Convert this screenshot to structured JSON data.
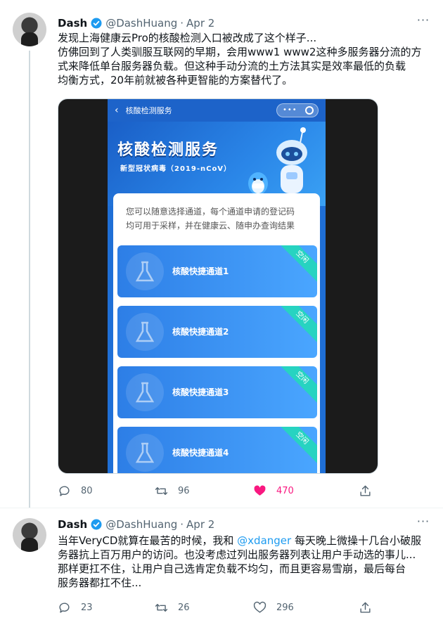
{
  "tweets": [
    {
      "name": "Dash",
      "handle": "@DashHuang",
      "dot": "·",
      "date": "Apr 2",
      "more": "···",
      "lines": [
        "发现上海健康云Pro的核酸检测入口被改成了这个样子...",
        "仿佛回到了人类驯服互联网的早期，会用www1 www2这种多服务器分流的方",
        "式来降低单台服务器负载。但这种手动分流的土方法其实是效率最低的负载",
        "均衡方式，20年前就被各种更智能的方案替代了。"
      ],
      "media": {
        "nav_title": "核酸检测服务",
        "capsule": "•••",
        "banner_title": "核酸检测服务",
        "banner_subtitle": "新型冠状病毒（2019-nCoV）",
        "description_lines": [
          "您可以随意选择通道，每个通道申请的登记码",
          "均可用于采样，并在健康云、随申办查询结果"
        ],
        "channels": [
          {
            "label": "核酸快捷通道1",
            "status": "空闲"
          },
          {
            "label": "核酸快捷通道2",
            "status": "空闲"
          },
          {
            "label": "核酸快捷通道3",
            "status": "空闲"
          },
          {
            "label": "核酸快捷通道4",
            "status": "空闲"
          }
        ]
      },
      "actions": {
        "replies": "80",
        "retweets": "96",
        "likes": "470"
      }
    },
    {
      "name": "Dash",
      "handle": "@DashHuang",
      "dot": "·",
      "date": "Apr 2",
      "more": "···",
      "line1_before": "当年VeryCD就算在最苦的时候，我和 ",
      "mention": "@xdanger",
      "line1_after": " 每天晚上微操十几台小破服",
      "lines": [
        "务器抗上百万用户的访问。也没考虑过列出服务器列表让用户手动选的事儿...",
        "那样更扛不住，让用户自己选肯定负载不均匀，而且更容易雪崩，最后每台",
        "服务器都扛不住..."
      ],
      "actions": {
        "replies": "23",
        "retweets": "26",
        "likes": "296"
      }
    }
  ],
  "colors": {
    "accent": "#1d9bf0",
    "like": "#f91880",
    "muted": "#536471",
    "channel_badge": "#27d3c1"
  }
}
